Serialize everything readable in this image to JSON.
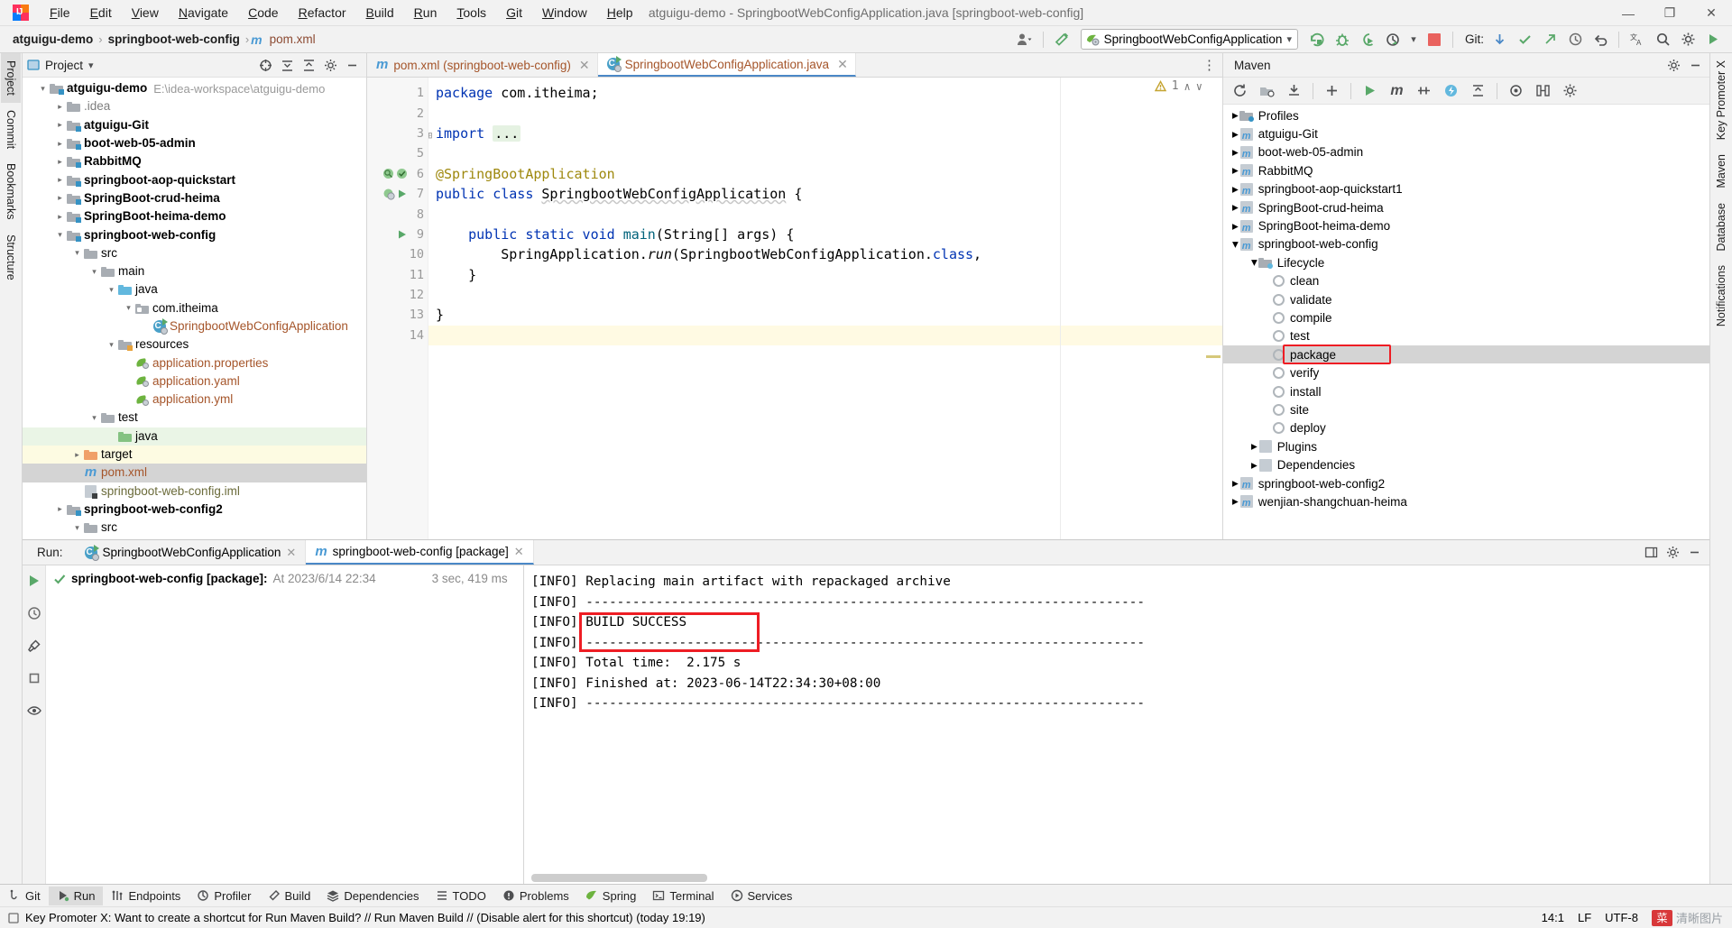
{
  "window": {
    "title": "atguigu-demo - SpringbootWebConfigApplication.java [springboot-web-config]",
    "minimize": "—",
    "maximize": "❐",
    "close": "✕"
  },
  "menu": [
    {
      "label": "File"
    },
    {
      "label": "Edit"
    },
    {
      "label": "View"
    },
    {
      "label": "Navigate"
    },
    {
      "label": "Code"
    },
    {
      "label": "Refactor"
    },
    {
      "label": "Build"
    },
    {
      "label": "Run"
    },
    {
      "label": "Tools"
    },
    {
      "label": "Git"
    },
    {
      "label": "Window"
    },
    {
      "label": "Help"
    }
  ],
  "navbar": {
    "breadcrumbs": [
      {
        "label": "atguigu-demo",
        "style": "bold"
      },
      {
        "label": "springboot-web-config",
        "style": "bold"
      },
      {
        "label": "pom.xml",
        "style": "file"
      }
    ],
    "separator": "›",
    "run_config": "SpringbootWebConfigApplication",
    "git_label": "Git:",
    "dropdown_caret": "▾"
  },
  "left_rail": [
    {
      "label": "Project",
      "selected": true
    },
    {
      "label": "Commit",
      "selected": false
    },
    {
      "label": "Bookmarks",
      "selected": false
    },
    {
      "label": "Structure",
      "selected": false
    }
  ],
  "right_rail": [
    {
      "label": "Key Promoter X"
    },
    {
      "label": "Maven"
    },
    {
      "label": "Database"
    },
    {
      "label": "Notifications"
    }
  ],
  "project_panel": {
    "title": "Project",
    "caret": "▾",
    "tree": [
      {
        "indent": 0,
        "arrow": "down",
        "icon": "module-folder",
        "label": "atguigu-demo",
        "bold": true,
        "sub": "E:\\idea-workspace\\atguigu-demo"
      },
      {
        "indent": 1,
        "arrow": "right",
        "icon": "folder-grey",
        "label": ".idea",
        "muted": true
      },
      {
        "indent": 1,
        "arrow": "right",
        "icon": "module-folder",
        "label": "atguigu-Git",
        "bold": true
      },
      {
        "indent": 1,
        "arrow": "right",
        "icon": "module-folder",
        "label": "boot-web-05-admin",
        "bold": true
      },
      {
        "indent": 1,
        "arrow": "right",
        "icon": "module-folder",
        "label": "RabbitMQ",
        "bold": true
      },
      {
        "indent": 1,
        "arrow": "right",
        "icon": "module-folder",
        "label": "springboot-aop-quickstart",
        "bold": true
      },
      {
        "indent": 1,
        "arrow": "right",
        "icon": "module-folder",
        "label": "SpringBoot-crud-heima",
        "bold": true
      },
      {
        "indent": 1,
        "arrow": "right",
        "icon": "module-folder",
        "label": "SpringBoot-heima-demo",
        "bold": true
      },
      {
        "indent": 1,
        "arrow": "down",
        "icon": "module-folder",
        "label": "springboot-web-config",
        "bold": true
      },
      {
        "indent": 2,
        "arrow": "down",
        "icon": "folder-grey",
        "label": "src"
      },
      {
        "indent": 3,
        "arrow": "down",
        "icon": "folder-grey",
        "label": "main"
      },
      {
        "indent": 4,
        "arrow": "down",
        "icon": "folder-blue",
        "label": "java"
      },
      {
        "indent": 5,
        "arrow": "down",
        "icon": "package",
        "label": "com.itheima"
      },
      {
        "indent": 6,
        "arrow": "none",
        "icon": "spring-class",
        "label": "SpringbootWebConfigApplication",
        "orange": true
      },
      {
        "indent": 4,
        "arrow": "down",
        "icon": "folder-res",
        "label": "resources"
      },
      {
        "indent": 5,
        "arrow": "none",
        "icon": "spring-file",
        "label": "application.properties",
        "orange": true
      },
      {
        "indent": 5,
        "arrow": "none",
        "icon": "spring-file",
        "label": "application.yaml",
        "orange": true
      },
      {
        "indent": 5,
        "arrow": "none",
        "icon": "spring-file",
        "label": "application.yml",
        "orange": true
      },
      {
        "indent": 3,
        "arrow": "down",
        "icon": "folder-grey",
        "label": "test"
      },
      {
        "indent": 4,
        "arrow": "none",
        "icon": "folder-green",
        "label": "java",
        "highlight": "green"
      },
      {
        "indent": 2,
        "arrow": "right",
        "icon": "folder-orange",
        "label": "target",
        "highlight": "yellow"
      },
      {
        "indent": 2,
        "arrow": "none",
        "icon": "maven-m",
        "label": "pom.xml",
        "orange": true,
        "highlight": "grey"
      },
      {
        "indent": 2,
        "arrow": "none",
        "icon": "iml",
        "label": "springboot-web-config.iml",
        "olive": true
      },
      {
        "indent": 1,
        "arrow": "right",
        "icon": "module-folder",
        "label": "springboot-web-config2",
        "bold": true
      },
      {
        "indent": 2,
        "arrow": "down",
        "icon": "folder-grey",
        "label": "src"
      }
    ]
  },
  "editor": {
    "tabs": [
      {
        "label": "pom.xml (springboot-web-config)",
        "icon": "maven-m",
        "active": false,
        "closable": true
      },
      {
        "label": "SpringbootWebConfigApplication.java",
        "icon": "spring-class",
        "active": true,
        "closable": true
      }
    ],
    "more_icon": "⋮",
    "warning_count": "1",
    "warning_up": "∧",
    "warning_down": "∨",
    "lines": [
      {
        "num": "1",
        "text": "package com.itheima;"
      },
      {
        "num": "2",
        "text": ""
      },
      {
        "num": "3",
        "text": "import ..."
      },
      {
        "num": "5",
        "text": ""
      },
      {
        "num": "6",
        "text": "@SpringBootApplication"
      },
      {
        "num": "7",
        "text": "public class SpringbootWebConfigApplication {"
      },
      {
        "num": "8",
        "text": ""
      },
      {
        "num": "9",
        "text": "    public static void main(String[] args) {"
      },
      {
        "num": "10",
        "text": "        SpringApplication.run(SpringbootWebConfigApplication.class,"
      },
      {
        "num": "11",
        "text": "    }"
      },
      {
        "num": "12",
        "text": ""
      },
      {
        "num": "13",
        "text": "}"
      },
      {
        "num": "14",
        "text": ""
      }
    ]
  },
  "maven_panel": {
    "title": "Maven",
    "toolbar_icons": [
      "reload-icon",
      "toggle-offline-icon",
      "download-sources-icon",
      "add-icon",
      "run-icon",
      "execute-maven-goal-icon",
      "skip-tests-icon",
      "show-dependencies-icon",
      "collapse-all-icon",
      "profiler-icon",
      "diagram-icon",
      "settings-icon"
    ],
    "tree": [
      {
        "indent": 0,
        "arrow": "right",
        "icon": "profiles",
        "label": "Profiles"
      },
      {
        "indent": 0,
        "arrow": "right",
        "icon": "maven-project",
        "label": "atguigu-Git"
      },
      {
        "indent": 0,
        "arrow": "right",
        "icon": "maven-project",
        "label": "boot-web-05-admin"
      },
      {
        "indent": 0,
        "arrow": "right",
        "icon": "maven-project",
        "label": "RabbitMQ"
      },
      {
        "indent": 0,
        "arrow": "right",
        "icon": "maven-project",
        "label": "springboot-aop-quickstart1"
      },
      {
        "indent": 0,
        "arrow": "right",
        "icon": "maven-project",
        "label": "SpringBoot-crud-heima"
      },
      {
        "indent": 0,
        "arrow": "right",
        "icon": "maven-project",
        "label": "SpringBoot-heima-demo"
      },
      {
        "indent": 0,
        "arrow": "down",
        "icon": "maven-project",
        "label": "springboot-web-config"
      },
      {
        "indent": 1,
        "arrow": "down",
        "icon": "lifecycle",
        "label": "Lifecycle"
      },
      {
        "indent": 2,
        "arrow": "none",
        "icon": "goal",
        "label": "clean"
      },
      {
        "indent": 2,
        "arrow": "none",
        "icon": "goal",
        "label": "validate"
      },
      {
        "indent": 2,
        "arrow": "none",
        "icon": "goal",
        "label": "compile"
      },
      {
        "indent": 2,
        "arrow": "none",
        "icon": "goal",
        "label": "test"
      },
      {
        "indent": 2,
        "arrow": "none",
        "icon": "goal",
        "label": "package",
        "selected": true,
        "annotated": true
      },
      {
        "indent": 2,
        "arrow": "none",
        "icon": "goal",
        "label": "verify"
      },
      {
        "indent": 2,
        "arrow": "none",
        "icon": "goal",
        "label": "install"
      },
      {
        "indent": 2,
        "arrow": "none",
        "icon": "goal",
        "label": "site"
      },
      {
        "indent": 2,
        "arrow": "none",
        "icon": "goal",
        "label": "deploy"
      },
      {
        "indent": 1,
        "arrow": "right",
        "icon": "plugins",
        "label": "Plugins"
      },
      {
        "indent": 1,
        "arrow": "right",
        "icon": "dependencies",
        "label": "Dependencies"
      },
      {
        "indent": 0,
        "arrow": "right",
        "icon": "maven-project",
        "label": "springboot-web-config2"
      },
      {
        "indent": 0,
        "arrow": "right",
        "icon": "maven-project",
        "label": "wenjian-shangchuan-heima"
      }
    ]
  },
  "run_panel": {
    "label": "Run:",
    "tabs": [
      {
        "label": "SpringbootWebConfigApplication",
        "icon": "spring-class",
        "active": false
      },
      {
        "label": "springboot-web-config [package]",
        "icon": "maven-m",
        "active": true
      }
    ],
    "result": {
      "title": "springboot-web-config [package]:",
      "timestamp": "At 2023/6/14 22:34",
      "duration": "3 sec, 419 ms",
      "status_icon": "check-icon"
    },
    "console": [
      "[INFO] Replacing main artifact with repackaged archive",
      "[INFO] ------------------------------------------------------------------------",
      "[INFO] BUILD SUCCESS",
      "[INFO] ------------------------------------------------------------------------",
      "[INFO] Total time:  2.175 s",
      "[INFO] Finished at: 2023-06-14T22:34:30+08:00",
      "[INFO] ------------------------------------------------------------------------"
    ],
    "annotated_line_index": 2
  },
  "tool_window_bar": [
    {
      "label": "Git",
      "icon": "git-icon",
      "selected": false
    },
    {
      "label": "Run",
      "icon": "run-icon",
      "selected": true
    },
    {
      "label": "Endpoints",
      "icon": "endpoints-icon",
      "selected": false
    },
    {
      "label": "Profiler",
      "icon": "profiler-icon",
      "selected": false
    },
    {
      "label": "Build",
      "icon": "build-icon",
      "selected": false
    },
    {
      "label": "Dependencies",
      "icon": "dependencies-icon",
      "selected": false
    },
    {
      "label": "TODO",
      "icon": "todo-icon",
      "selected": false
    },
    {
      "label": "Problems",
      "icon": "problems-icon",
      "selected": false
    },
    {
      "label": "Spring",
      "icon": "spring-icon",
      "selected": false
    },
    {
      "label": "Terminal",
      "icon": "terminal-icon",
      "selected": false
    },
    {
      "label": "Services",
      "icon": "services-icon",
      "selected": false
    }
  ],
  "status_bar": {
    "message": "Key Promoter X: Want to create a shortcut for Run Maven Build? // Run Maven Build // (Disable alert for this shortcut) (today 19:19)",
    "caret_position": "14:1",
    "line_separator": "LF",
    "encoding": "UTF-8",
    "watermark_badge": "菜",
    "watermark_text": "清晰图片"
  },
  "colors": {
    "accent_blue": "#4a88c7",
    "success_green": "#59a869",
    "annotation_red": "#ee1d24",
    "keyword_blue": "#0033b3",
    "annotation_gold": "#9e880d",
    "file_orange": "#a5552a"
  }
}
